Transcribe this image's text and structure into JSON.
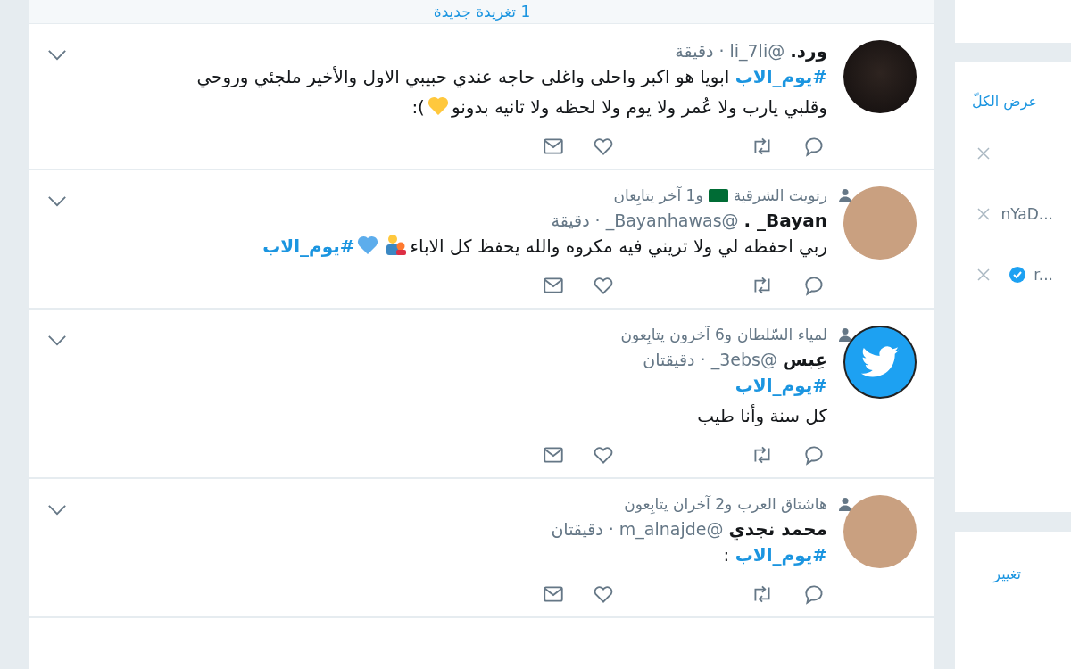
{
  "new_tweets_bar": "1 تغريدة جديدة",
  "tweets": [
    {
      "name": "ورد.",
      "handle": "@li_7li",
      "separator": "·",
      "time": "دقيقة",
      "avatar": {
        "kind": "dark"
      },
      "body": [
        [
          {
            "kind": "hashtag",
            "text": "#يوم_الاب"
          },
          {
            "kind": "text",
            "text": " ابويا هو اكبر واحلى واغلى حاجه عندي حبيبي الاول والأخير ملجئي وروحي وقلبي يارب ولا عُمر ولا يوم ولا لحظه ولا ثانيه بدونو"
          },
          {
            "kind": "heart",
            "color": "#ffc83d"
          },
          {
            "kind": "text",
            "text": "):"
          }
        ]
      ]
    },
    {
      "context": {
        "name": "رتويت الشرقية",
        "flag": true,
        "rest": "و1 آخر يتابِعان"
      },
      "name": "Bayan_ .",
      "handle": "@Bayanhawas_",
      "separator": "·",
      "time": "دقيقة",
      "avatar": {
        "kind": "photo"
      },
      "body": [
        [
          {
            "kind": "text",
            "text": "ربي احفظه لي ولا تريني فيه مكروه والله يحفظ كل الاباء"
          },
          {
            "kind": "family"
          },
          {
            "kind": "heart",
            "color": "#5dadec"
          },
          {
            "kind": "hashtag",
            "text": "#يوم_الاب"
          }
        ]
      ]
    },
    {
      "context": {
        "name": "لمياء السّلطان",
        "flag": false,
        "rest": "و6 آخرون يتابِعون"
      },
      "name": "عِبس",
      "handle": "@3ebs_",
      "separator": "·",
      "time": "دقيقتان",
      "avatar": {
        "kind": "bird"
      },
      "body": [
        [
          {
            "kind": "hashtag",
            "text": "#يوم_الاب"
          }
        ],
        [
          {
            "kind": "text",
            "text": "كل سنة وأنا طيب"
          }
        ]
      ]
    },
    {
      "context": {
        "name": "هاشتاق العرب",
        "flag": false,
        "rest": "و2 آخران يتابِعون"
      },
      "name": "محمد نجدي",
      "handle": "@m_alnajde",
      "separator": "·",
      "time": "دقيقتان",
      "avatar": {
        "kind": "photo"
      },
      "body": [
        [
          {
            "kind": "hashtag",
            "text": "#يوم_الاب"
          },
          {
            "kind": "text",
            "text": " :"
          }
        ]
      ]
    }
  ],
  "sidebar": {
    "view_all": "عرض الكلّ",
    "suggestions": [
      {
        "verified": false
      },
      {
        "text": "nYaD...",
        "verified": false
      },
      {
        "text": "r...",
        "verified": true
      }
    ],
    "change": "تغيير"
  }
}
